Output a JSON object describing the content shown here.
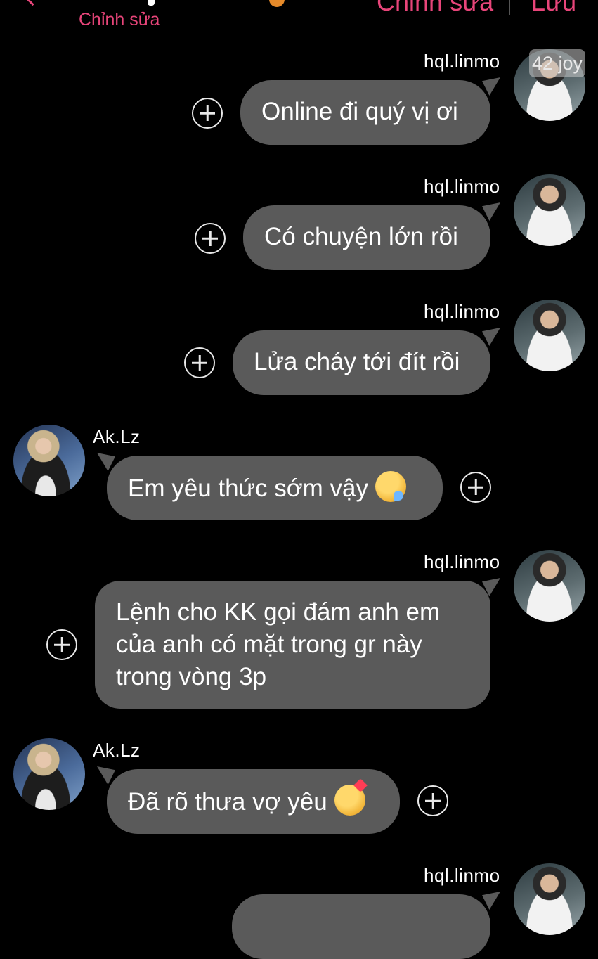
{
  "header": {
    "subtitle": "Chỉnh sửa",
    "edit_label": "Chỉnh sửa",
    "save_label": "Lưu"
  },
  "avatar_watermark": "42 joy",
  "messages": [
    {
      "sender": "hql.linmo",
      "side": "right",
      "text": "Online đi quý vị ơi"
    },
    {
      "sender": "hql.linmo",
      "side": "right",
      "text": "Có chuyện lớn rồi"
    },
    {
      "sender": "hql.linmo",
      "side": "right",
      "text": "Lửa cháy tới đít rồi"
    },
    {
      "sender": "Ak.Lz",
      "side": "left",
      "text": "Em yêu thức sớm vậy",
      "emoji": "sleepy-face-emoji"
    },
    {
      "sender": "hql.linmo",
      "side": "right",
      "text": "Lệnh cho KK gọi đám anh em\ncủa anh có mặt trong gr này\ntrong vòng 3p"
    },
    {
      "sender": "Ak.Lz",
      "side": "left",
      "text": "Đã rõ thưa vợ yêu",
      "emoji": "smiling-face-with-hearts-emoji"
    },
    {
      "sender": "hql.linmo",
      "side": "right",
      "text": ""
    }
  ],
  "colors": {
    "background": "#000000",
    "accent": "#e8457a",
    "bubble": "#5a5a5a",
    "text": "#ffffff"
  }
}
